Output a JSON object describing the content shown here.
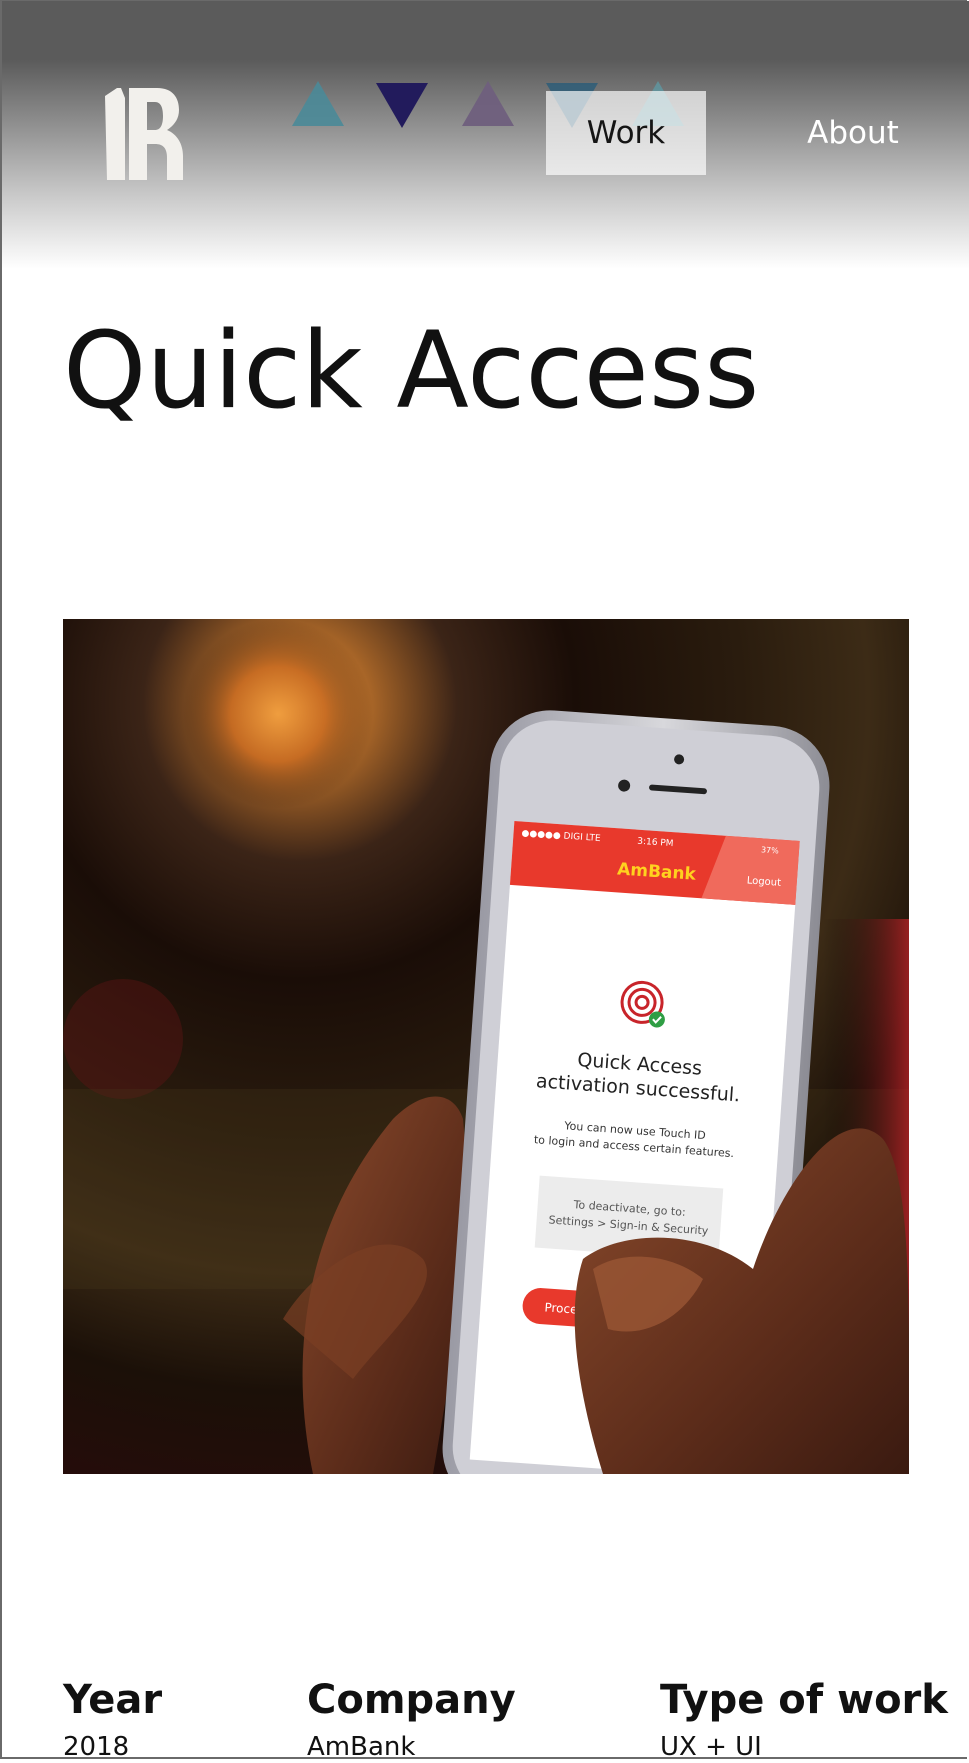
{
  "nav": {
    "logo": "logo-icon",
    "work_label": "Work",
    "about_label": "About"
  },
  "page": {
    "title": "Quick Access"
  },
  "hero": {
    "phone_screen": {
      "carrier": "●●●●● DIGI LTE",
      "time": "3:16 PM",
      "battery": "37%",
      "brand": "AmBank",
      "logout": "Logout",
      "heading_line1": "Quick Access",
      "heading_line2": "activation successful.",
      "body_line1": "You can now use Touch ID",
      "body_line2": "to login and access certain features.",
      "hint_line1": "To deactivate, go to:",
      "hint_line2": "Settings > Sign-in & Security",
      "button_label": "Proce"
    }
  },
  "meta": {
    "year_heading": "Year",
    "year_value": "2018",
    "company_heading": "Company",
    "company_value": "AmBank",
    "type_heading": "Type of work",
    "type_value": "UX + UI"
  },
  "colors": {
    "header_top": "#5b5b5b",
    "ambank_red": "#e8392c",
    "brand_yellow": "#ffd21f",
    "triangle_teal": "#4a8a98",
    "triangle_navy": "#221b5c",
    "triangle_mauve": "#6f5f7d"
  }
}
